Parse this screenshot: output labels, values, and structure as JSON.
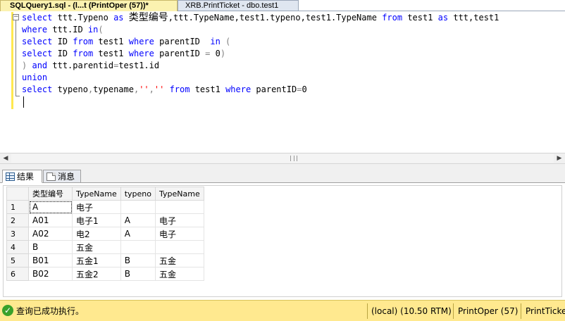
{
  "tabs": {
    "active": "SQLQuery1.sql - (l...t (PrintOper (57))*",
    "inactive": "XRB.PrintTicket - dbo.test1"
  },
  "editor": {
    "lines": [
      [
        [
          "kw",
          "select"
        ],
        [
          "t",
          " ttt.Typeno "
        ],
        [
          "kw",
          "as"
        ],
        [
          "t",
          " "
        ],
        [
          "cjk",
          "类型编号"
        ],
        [
          "t",
          ",ttt.TypeName,test1.typeno,test1.TypeName "
        ],
        [
          "kw",
          "from"
        ],
        [
          "t",
          " test1 "
        ],
        [
          "kw",
          "as"
        ],
        [
          "t",
          " ttt,test1"
        ]
      ],
      [
        [
          "kw",
          "where"
        ],
        [
          "t",
          " ttt.ID "
        ],
        [
          "kw",
          "in"
        ],
        [
          "cmt",
          "("
        ]
      ],
      [
        [
          "kw",
          "select"
        ],
        [
          "t",
          " ID "
        ],
        [
          "kw",
          "from"
        ],
        [
          "t",
          " test1 "
        ],
        [
          "kw",
          "where"
        ],
        [
          "t",
          " parentID  "
        ],
        [
          "kw",
          "in"
        ],
        [
          "t",
          " "
        ],
        [
          "cmt",
          "("
        ]
      ],
      [
        [
          "kw",
          "select"
        ],
        [
          "t",
          " ID "
        ],
        [
          "kw",
          "from"
        ],
        [
          "t",
          " test1 "
        ],
        [
          "kw",
          "where"
        ],
        [
          "t",
          " parentID "
        ],
        [
          "cmt",
          "="
        ],
        [
          "t",
          " 0"
        ],
        [
          "cmt",
          ")"
        ]
      ],
      [
        [
          "cmt",
          ")"
        ],
        [
          "t",
          " "
        ],
        [
          "kw",
          "and"
        ],
        [
          "t",
          " ttt.parentid"
        ],
        [
          "cmt",
          "="
        ],
        [
          "t",
          "test1.id"
        ]
      ],
      [
        [
          "kw",
          "union"
        ]
      ],
      [
        [
          "kw",
          "select"
        ],
        [
          "t",
          " typeno"
        ],
        [
          "cmt",
          ","
        ],
        [
          "t",
          "typename"
        ],
        [
          "cmt",
          ","
        ],
        [
          "str",
          "''"
        ],
        [
          "cmt",
          ","
        ],
        [
          "str",
          "''"
        ],
        [
          "t",
          " "
        ],
        [
          "kw",
          "from"
        ],
        [
          "t",
          " test1 "
        ],
        [
          "kw",
          "where"
        ],
        [
          "t",
          " parentID"
        ],
        [
          "cmt",
          "="
        ],
        [
          "t",
          "0"
        ]
      ]
    ]
  },
  "result_tabs": {
    "results": "结果",
    "messages": "消息"
  },
  "grid": {
    "columns": [
      "类型编号",
      "TypeName",
      "typeno",
      "TypeName"
    ],
    "rows": [
      [
        "1",
        "A",
        "电子",
        "",
        ""
      ],
      [
        "2",
        "A01",
        "电子1",
        "A",
        "电子"
      ],
      [
        "3",
        "A02",
        "电2",
        "A",
        "电子"
      ],
      [
        "4",
        "B",
        "五金",
        "",
        ""
      ],
      [
        "5",
        "B01",
        "五金1",
        "B",
        "五金"
      ],
      [
        "6",
        "B02",
        "五金2",
        "B",
        "五金"
      ]
    ]
  },
  "status": {
    "message": "查询已成功执行。",
    "server": "(local) (10.50 RTM)",
    "user": "PrintOper (57)",
    "database": "PrintTicket"
  },
  "colors": {
    "keyword": "#0000ff",
    "operator": "#808080",
    "string": "#ff0000",
    "status_bar": "#ffe98f",
    "active_tab": "#fbf2b0"
  }
}
